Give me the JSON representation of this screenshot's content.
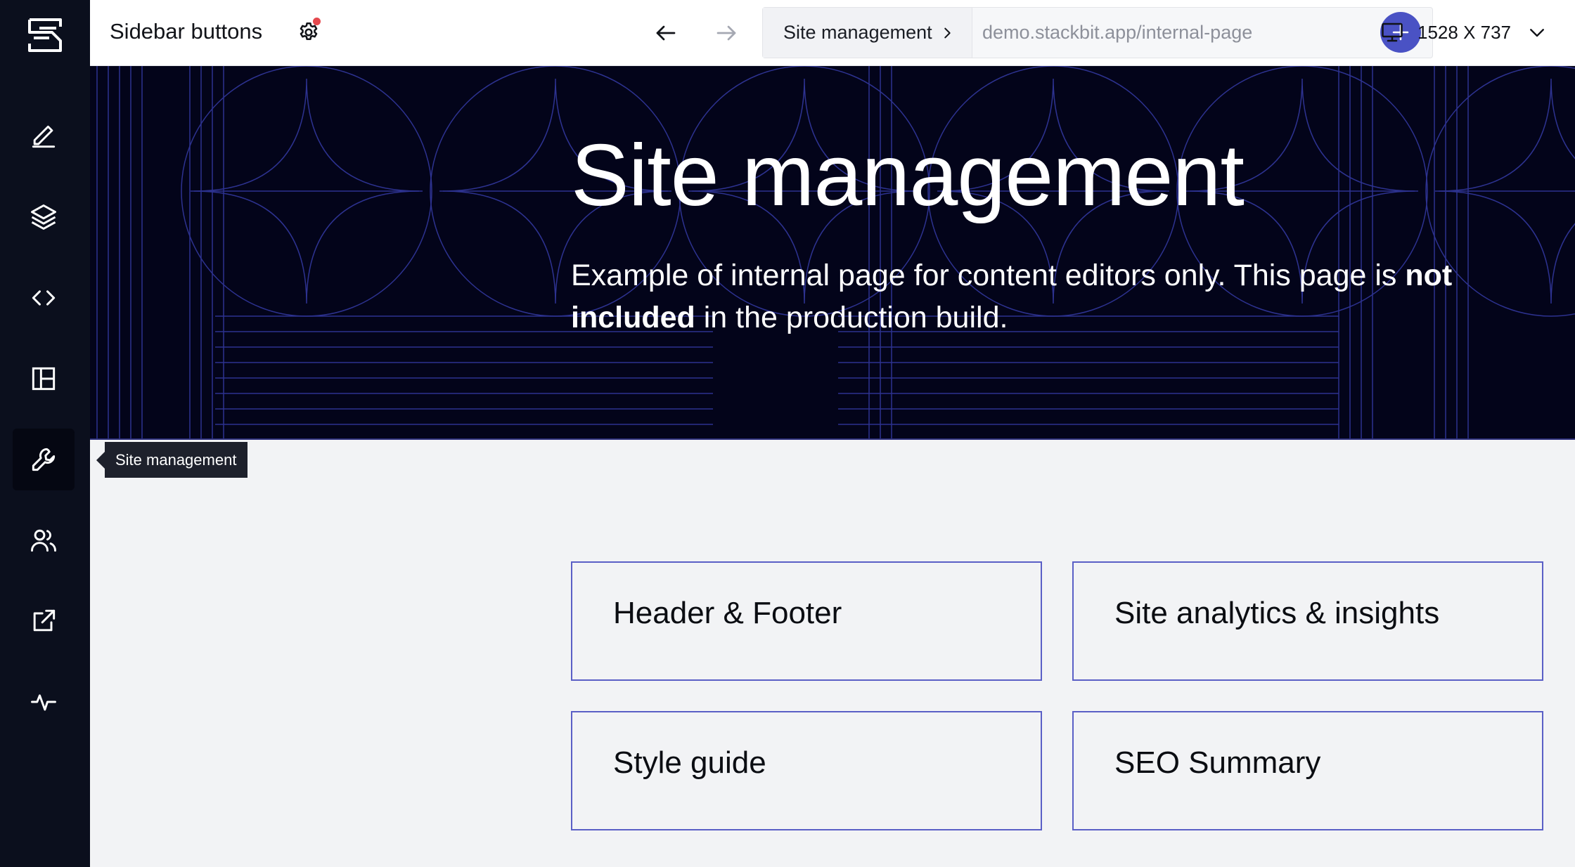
{
  "sidebar": {
    "items": [
      {
        "icon": "pencil-icon",
        "name": "edit"
      },
      {
        "icon": "layers-icon",
        "name": "content"
      },
      {
        "icon": "code-icon",
        "name": "code"
      },
      {
        "icon": "layout-icon",
        "name": "layout"
      },
      {
        "icon": "wrench-icon",
        "name": "site-management",
        "active": true
      },
      {
        "icon": "users-icon",
        "name": "collaborators"
      },
      {
        "icon": "external-link-icon",
        "name": "open-site"
      },
      {
        "icon": "activity-icon",
        "name": "activity"
      }
    ],
    "tooltip": "Site management"
  },
  "header": {
    "project_title": "Sidebar buttons",
    "settings_has_notification": true,
    "page_name": "Site management",
    "url": "demo.stackbit.app/internal-page",
    "device_size": "1528 X 737"
  },
  "hero": {
    "title": "Site management",
    "desc_part1": "Example of internal page for content editors only. This page is ",
    "desc_bold1": "not included",
    "desc_part2": " in the production build."
  },
  "cards": [
    {
      "label": "Header & Footer"
    },
    {
      "label": "Site analytics & insights"
    },
    {
      "label": "Style guide"
    },
    {
      "label": "SEO Summary"
    }
  ],
  "colors": {
    "rail_bg": "#0b0f1d",
    "hero_bg": "#03041a",
    "accent": "#4a52c4",
    "card_border": "#5a5fc6",
    "notification": "#e5484d"
  }
}
